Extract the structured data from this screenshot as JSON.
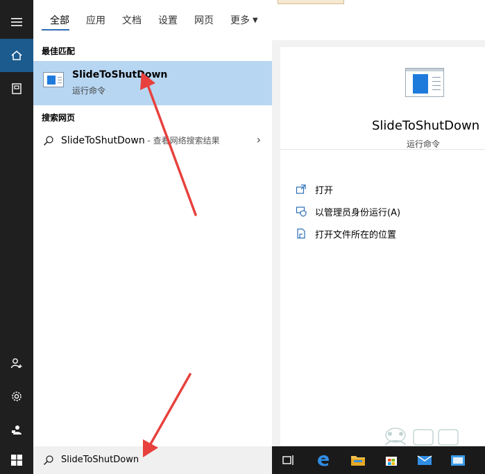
{
  "tabs": [
    {
      "label": "全部",
      "active": true
    },
    {
      "label": "应用"
    },
    {
      "label": "文档"
    },
    {
      "label": "设置"
    },
    {
      "label": "网页"
    },
    {
      "label": "更多"
    }
  ],
  "results": {
    "best_match_title": "最佳匹配",
    "best_match": {
      "name": "SlideToShutDown",
      "subtitle": "运行命令"
    },
    "web_title": "搜索网页",
    "web_item": {
      "name": "SlideToShutDown",
      "suffix": " - 查看网络搜索结果"
    }
  },
  "detail": {
    "title": "SlideToShutDown",
    "subtitle": "运行命令",
    "actions": [
      "打开",
      "以管理员身份运行(A)",
      "打开文件所在的位置"
    ]
  },
  "search": {
    "query": "SlideToShutDown"
  },
  "colors": {
    "accent": "#2b6db5",
    "selected": "#b7d6f2",
    "arrow": "#e8413d"
  }
}
